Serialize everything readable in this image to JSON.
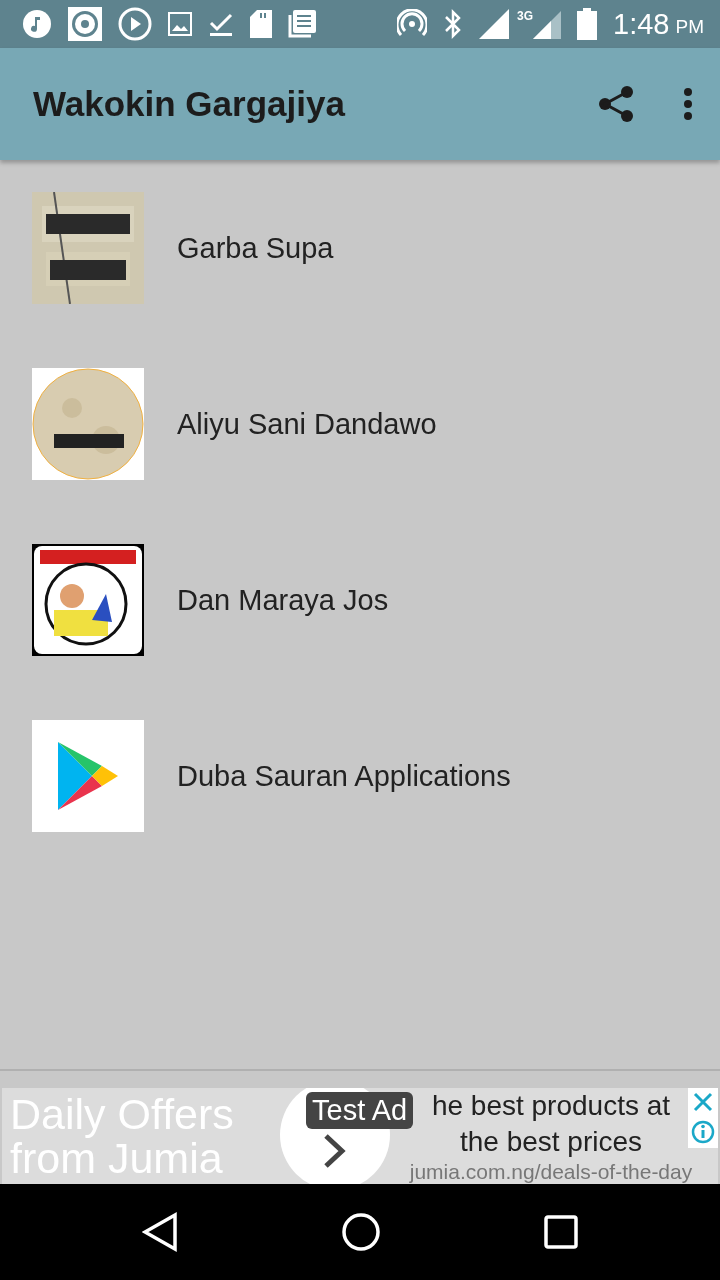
{
  "status_bar": {
    "time": "1:48",
    "ampm": "PM",
    "network": "3G"
  },
  "app_bar": {
    "title": "Wakokin Gargajiya"
  },
  "items": [
    {
      "kind": "picture",
      "label": "Garba Supa"
    },
    {
      "kind": "picture",
      "label": "Aliyu Sani Dandawo"
    },
    {
      "kind": "picture",
      "label": "Dan Maraya Jos"
    },
    {
      "kind": "store",
      "label": "Duba Sauran Applications"
    }
  ],
  "ad": {
    "headline": "Daily Offers from Jumia",
    "badge": "Test Ad",
    "text": "he best products at the best prices",
    "url": "jumia.com.ng/deals-of-the-day"
  }
}
